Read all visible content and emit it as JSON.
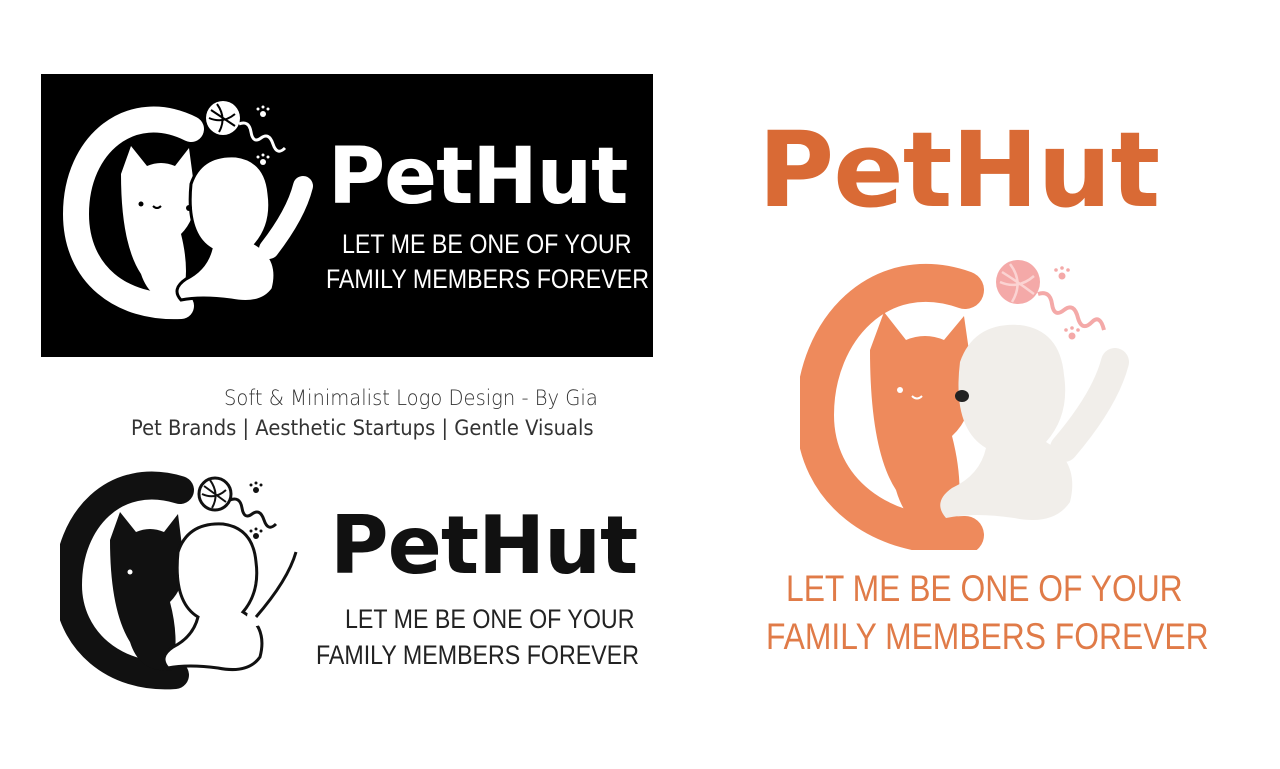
{
  "brand": {
    "name": "PetHut",
    "tagline_line1": "LET ME BE ONE OF YOUR",
    "tagline_line2": "FAMILY MEMBERS FOREVER"
  },
  "captions": {
    "line1": "Soft & Minimalist Logo Design - By Gia",
    "line2": "Pet Brands | Aesthetic Startups | Gentle Visuals"
  },
  "colors": {
    "dark_card_bg": "#000000",
    "brand_orange": "#d96a35",
    "tagline_orange": "#e07b48",
    "cat_orange": "#ee8a5c",
    "dog_cream": "#f1eeea",
    "yarn_pink": "#f4a9a8"
  },
  "icons": [
    "cat-icon",
    "dog-icon",
    "yarn-ball-icon",
    "paw-print-icon"
  ]
}
